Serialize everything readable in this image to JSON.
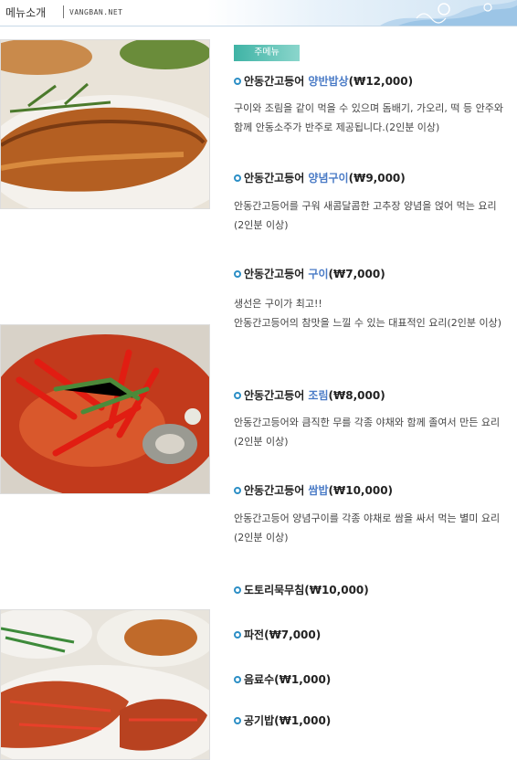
{
  "header": {
    "title": "메뉴소개",
    "site": "VANGBAN.NET"
  },
  "section_tag": "주메뉴",
  "menu": [
    {
      "prefix": "안동간고등어 ",
      "highlight": "양반밥상",
      "price": "(₩12,000)",
      "desc": "구이와 조림을 같이 먹을 수 있으며 돔배기, 가오리, 떡 등 안주와 함께 안동소주가 반주로 제공됩니다.(2인분 이상)"
    },
    {
      "prefix": "안동간고등어 ",
      "highlight": "양념구이",
      "price": "(₩9,000)",
      "desc": "안동간고등어를 구워 새콤달콤한 고추장 양념을 얹어 먹는 요리(2인분 이상)"
    },
    {
      "prefix": "안동간고등어 ",
      "highlight": "구이",
      "price": "(₩7,000)",
      "desc_line1": "생선은 구이가 최고!!",
      "desc": "안동간고등어의 참맛을 느낄 수 있는 대표적인 요리(2인분 이상)"
    },
    {
      "prefix": "안동간고등어 ",
      "highlight": "조림",
      "price": "(₩8,000)",
      "desc": "안동간고등어와 큼직한 무를 각종 야채와 함께 졸여서 만든 요리(2인분 이상)"
    },
    {
      "prefix": "안동간고등어 ",
      "highlight": "쌈밥",
      "price": "(₩10,000)",
      "desc": "안동간고등어 양념구이를 각종 야채로 쌈을 싸서 먹는 별미 요리(2인분 이상)"
    }
  ],
  "extras": [
    {
      "label": "도토리묵무침(₩10,000)"
    },
    {
      "label": "파전(₩7,000)"
    },
    {
      "label": "음료수(₩1,000)"
    },
    {
      "label": "공기밥(₩1,000)"
    }
  ],
  "colors": {
    "accent": "#4a7bc6",
    "bullet": "#2d8fc6",
    "tag": "#3fb3a5"
  }
}
